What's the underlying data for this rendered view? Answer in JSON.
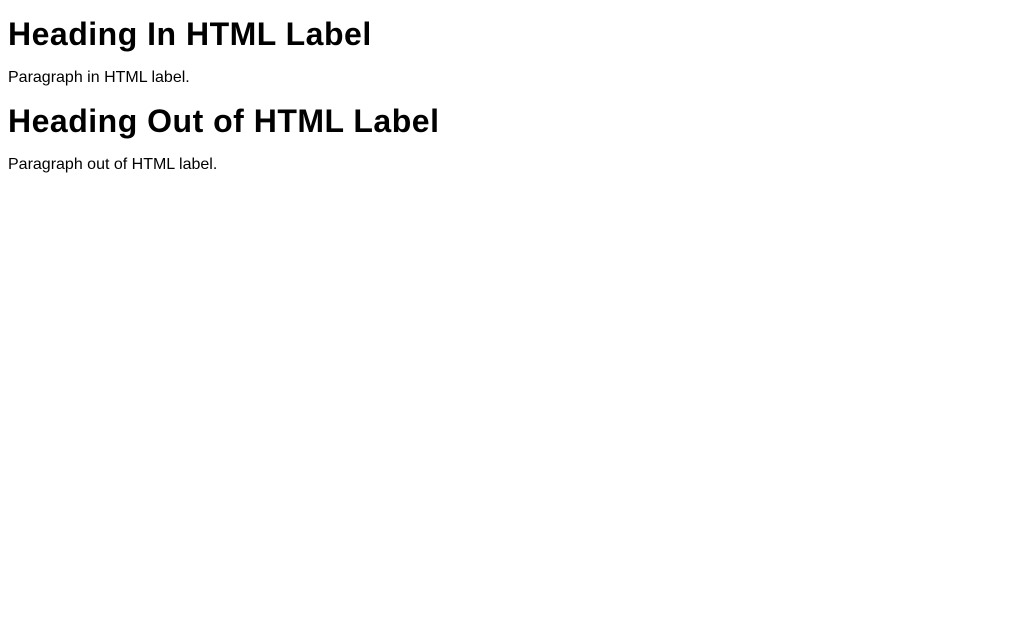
{
  "section1": {
    "heading": "Heading In HTML Label",
    "paragraph": "Paragraph in HTML label."
  },
  "section2": {
    "heading": "Heading Out of HTML Label",
    "paragraph": "Paragraph out of HTML label."
  }
}
